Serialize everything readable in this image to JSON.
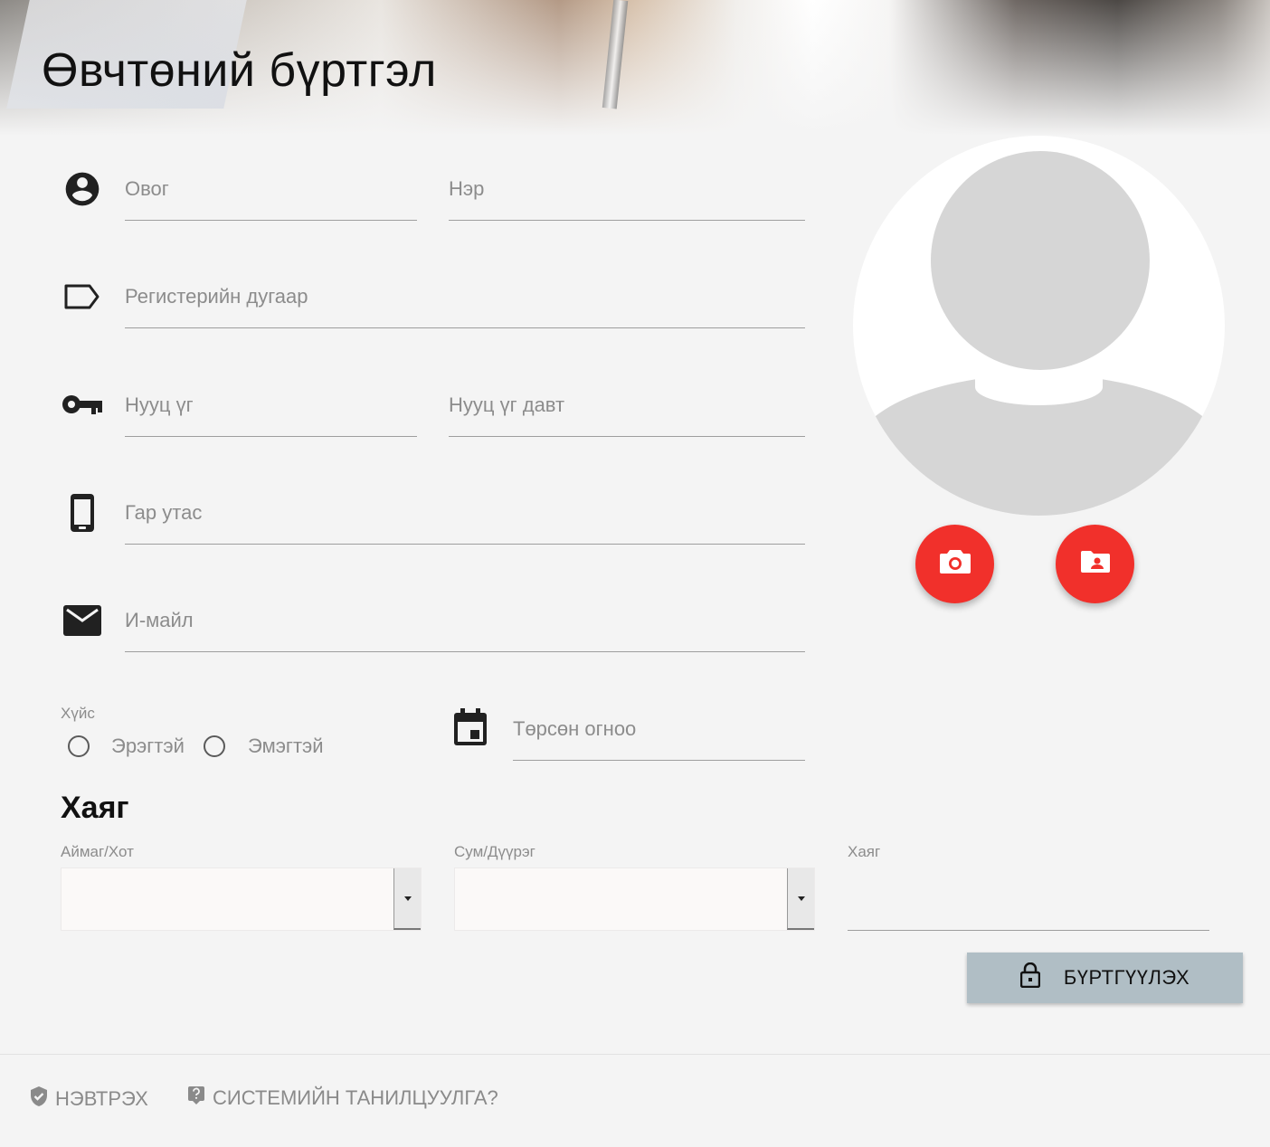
{
  "header": {
    "title": "Өвчтөний бүртгэл"
  },
  "form": {
    "last_name": {
      "placeholder": "Овог"
    },
    "first_name": {
      "placeholder": "Нэр"
    },
    "register_number": {
      "placeholder": "Регистерийн дугаар"
    },
    "password": {
      "placeholder": "Нууц үг"
    },
    "password_repeat": {
      "placeholder": "Нууц үг давт"
    },
    "phone": {
      "placeholder": "Гар утас"
    },
    "email": {
      "placeholder": "И-майл"
    },
    "gender": {
      "label": "Хүйс",
      "options": [
        "Эрэгтэй",
        "Эмэгтэй"
      ]
    },
    "birth_date": {
      "placeholder": "Төрсөн огноо"
    }
  },
  "address": {
    "title": "Хаяг",
    "province_label": "Аймаг/Хот",
    "district_label": "Сум/Дүүрэг",
    "address_label": "Хаяг"
  },
  "avatar": {
    "icons": [
      "camera-icon",
      "folder-user-icon"
    ],
    "button_color": "#f1302b"
  },
  "submit": {
    "label": "БҮРТГҮҮЛЭХ",
    "icon": "lock-icon",
    "color": "#b0bec5"
  },
  "footer": {
    "login_label": "НЭВТРЭХ",
    "intro_label": "СИСТЕМИЙН ТАНИЛЦУУЛГА?"
  }
}
